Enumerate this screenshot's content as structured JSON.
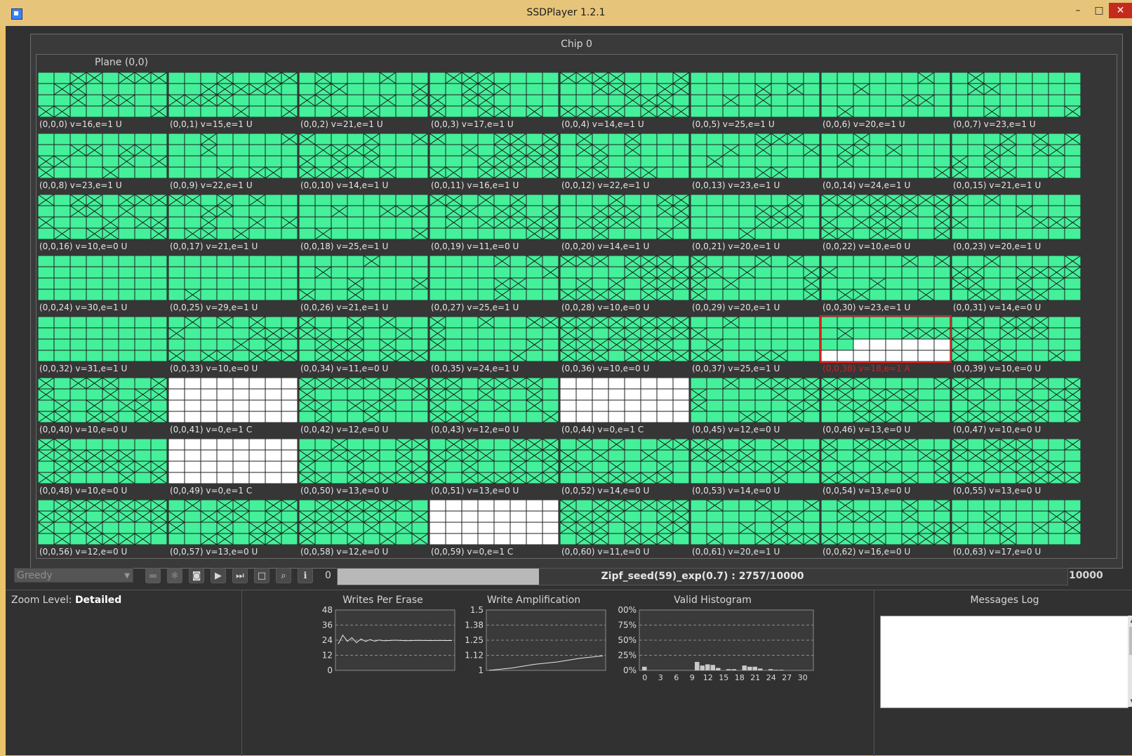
{
  "window": {
    "title": "SSDPlayer 1.2.1",
    "min": "–",
    "max": "□",
    "close": "✕"
  },
  "chip_title": "Chip 0",
  "plane_title": "Plane (0,0)",
  "blocks": [
    {
      "label": "(0,0,0) v=16,e=1 U",
      "state": "mixed"
    },
    {
      "label": "(0,0,1) v=15,e=1 U",
      "state": "mixed"
    },
    {
      "label": "(0,0,2) v=21,e=1 U",
      "state": "mixed"
    },
    {
      "label": "(0,0,3) v=17,e=1 U",
      "state": "mixed"
    },
    {
      "label": "(0,0,4) v=14,e=1 U",
      "state": "mixed"
    },
    {
      "label": "(0,0,5) v=25,e=1 U",
      "state": "mixed"
    },
    {
      "label": "(0,0,6) v=20,e=1 U",
      "state": "mixed"
    },
    {
      "label": "(0,0,7) v=23,e=1 U",
      "state": "mixed"
    },
    {
      "label": "(0,0,8) v=23,e=1 U",
      "state": "mixed"
    },
    {
      "label": "(0,0,9) v=22,e=1 U",
      "state": "mixed"
    },
    {
      "label": "(0,0,10) v=14,e=1 U",
      "state": "mixed"
    },
    {
      "label": "(0,0,11) v=16,e=1 U",
      "state": "mixed"
    },
    {
      "label": "(0,0,12) v=22,e=1 U",
      "state": "mixed"
    },
    {
      "label": "(0,0,13) v=23,e=1 U",
      "state": "mixed"
    },
    {
      "label": "(0,0,14) v=24,e=1 U",
      "state": "mixed"
    },
    {
      "label": "(0,0,15) v=21,e=1 U",
      "state": "mixed"
    },
    {
      "label": "(0,0,16) v=10,e=0 U",
      "state": "mixed"
    },
    {
      "label": "(0,0,17) v=21,e=1 U",
      "state": "mixed"
    },
    {
      "label": "(0,0,18) v=25,e=1 U",
      "state": "mixed"
    },
    {
      "label": "(0,0,19) v=11,e=0 U",
      "state": "mixed"
    },
    {
      "label": "(0,0,20) v=14,e=1 U",
      "state": "mixed"
    },
    {
      "label": "(0,0,21) v=20,e=1 U",
      "state": "mixed"
    },
    {
      "label": "(0,0,22) v=10,e=0 U",
      "state": "mixed"
    },
    {
      "label": "(0,0,23) v=20,e=1 U",
      "state": "mixed"
    },
    {
      "label": "(0,0,24) v=30,e=1 U",
      "state": "mixed"
    },
    {
      "label": "(0,0,25) v=29,e=1 U",
      "state": "mixed"
    },
    {
      "label": "(0,0,26) v=21,e=1 U",
      "state": "mixed"
    },
    {
      "label": "(0,0,27) v=25,e=1 U",
      "state": "mixed"
    },
    {
      "label": "(0,0,28) v=10,e=0 U",
      "state": "mixed"
    },
    {
      "label": "(0,0,29) v=20,e=1 U",
      "state": "mixed"
    },
    {
      "label": "(0,0,30) v=23,e=1 U",
      "state": "mixed"
    },
    {
      "label": "(0,0,31) v=14,e=0 U",
      "state": "mixed"
    },
    {
      "label": "(0,0,32) v=31,e=1 U",
      "state": "mixed"
    },
    {
      "label": "(0,0,33) v=10,e=0 U",
      "state": "mixed"
    },
    {
      "label": "(0,0,34) v=11,e=0 U",
      "state": "mixed"
    },
    {
      "label": "(0,0,35) v=24,e=1 U",
      "state": "mixed"
    },
    {
      "label": "(0,0,36) v=10,e=0 U",
      "state": "mixed"
    },
    {
      "label": "(0,0,37) v=25,e=1 U",
      "state": "mixed"
    },
    {
      "label": "(0,0,38) v=18,e=1 A",
      "state": "active"
    },
    {
      "label": "(0,0,39) v=10,e=0 U",
      "state": "mixed"
    },
    {
      "label": "(0,0,40) v=10,e=0 U",
      "state": "mixed"
    },
    {
      "label": "(0,0,41) v=0,e=1 C",
      "state": "clean"
    },
    {
      "label": "(0,0,42) v=12,e=0 U",
      "state": "mixed"
    },
    {
      "label": "(0,0,43) v=12,e=0 U",
      "state": "mixed"
    },
    {
      "label": "(0,0,44) v=0,e=1 C",
      "state": "clean"
    },
    {
      "label": "(0,0,45) v=12,e=0 U",
      "state": "mixed"
    },
    {
      "label": "(0,0,46) v=13,e=0 U",
      "state": "mixed"
    },
    {
      "label": "(0,0,47) v=10,e=0 U",
      "state": "mixed"
    },
    {
      "label": "(0,0,48) v=10,e=0 U",
      "state": "mixed"
    },
    {
      "label": "(0,0,49) v=0,e=1 C",
      "state": "clean"
    },
    {
      "label": "(0,0,50) v=13,e=0 U",
      "state": "mixed"
    },
    {
      "label": "(0,0,51) v=13,e=0 U",
      "state": "mixed"
    },
    {
      "label": "(0,0,52) v=14,e=0 U",
      "state": "mixed"
    },
    {
      "label": "(0,0,53) v=14,e=0 U",
      "state": "mixed"
    },
    {
      "label": "(0,0,54) v=13,e=0 U",
      "state": "mixed"
    },
    {
      "label": "(0,0,55) v=13,e=0 U",
      "state": "mixed"
    },
    {
      "label": "(0,0,56) v=12,e=0 U",
      "state": "mixed"
    },
    {
      "label": "(0,0,57) v=13,e=0 U",
      "state": "mixed"
    },
    {
      "label": "(0,0,58) v=12,e=0 U",
      "state": "mixed"
    },
    {
      "label": "(0,0,59) v=0,e=1 C",
      "state": "clean"
    },
    {
      "label": "(0,0,60) v=11,e=0 U",
      "state": "mixed"
    },
    {
      "label": "(0,0,61) v=20,e=1 U",
      "state": "mixed"
    },
    {
      "label": "(0,0,62) v=16,e=0 U",
      "state": "mixed"
    },
    {
      "label": "(0,0,63) v=17,e=0 U",
      "state": "mixed"
    }
  ],
  "colors": {
    "valid_page": "#44f09a",
    "clean_page": "#ffffff",
    "selected": "#d62020"
  },
  "toolbar": {
    "manager": "Greedy",
    "counter_start": "0",
    "progress_text": "Zipf_seed(59)_exp(0.7) : 2757/10000",
    "progress_fraction": 0.2757,
    "counter_end": "10000",
    "icons": [
      "stop-icon",
      "settings-icon",
      "camera-icon",
      "play-icon",
      "step-icon",
      "square-icon",
      "zoom-icon",
      "info-icon"
    ]
  },
  "zoom": {
    "label": "Zoom Level:",
    "value": "Detailed"
  },
  "charts": [
    {
      "title": "Writes Per Erase",
      "type": "line",
      "yticks": [
        "48",
        "36",
        "24",
        "12",
        "0"
      ]
    },
    {
      "title": "Write Amplification",
      "type": "line",
      "yticks": [
        "1.5",
        "1.38",
        "1.25",
        "1.12",
        "1"
      ]
    },
    {
      "title": "Valid Histogram",
      "type": "bar",
      "yticks": [
        "00%",
        "75%",
        "50%",
        "25%",
        "0%"
      ],
      "xticks": [
        "0",
        "3",
        "6",
        "9",
        "12",
        "15",
        "18",
        "21",
        "24",
        "27",
        "30"
      ]
    }
  ],
  "chart_data": [
    {
      "type": "line",
      "title": "Writes Per Erase",
      "ylim": [
        0,
        48
      ],
      "x": [
        0,
        0.04,
        0.08,
        0.12,
        0.16,
        0.2,
        0.24,
        0.28,
        0.32,
        0.36,
        0.4,
        0.5,
        0.6,
        0.7,
        0.8,
        0.9,
        1.0
      ],
      "values": [
        21,
        28,
        23,
        26,
        22,
        25,
        23,
        24.5,
        23.2,
        24.1,
        23.5,
        24,
        23.6,
        23.9,
        23.7,
        23.8,
        23.7
      ]
    },
    {
      "type": "line",
      "title": "Write Amplification",
      "ylim": [
        1,
        1.5
      ],
      "x": [
        0,
        0.2,
        0.4,
        0.6,
        0.8,
        1.0
      ],
      "values": [
        1.0,
        1.02,
        1.05,
        1.07,
        1.1,
        1.12
      ]
    },
    {
      "type": "bar",
      "title": "Valid Histogram",
      "ylim": [
        0,
        100
      ],
      "categories": [
        "0",
        "1",
        "2",
        "3",
        "4",
        "5",
        "6",
        "7",
        "8",
        "9",
        "10",
        "11",
        "12",
        "13",
        "14",
        "15",
        "16",
        "17",
        "18",
        "19",
        "20",
        "21",
        "22",
        "23",
        "24",
        "25",
        "26",
        "27",
        "28",
        "29",
        "30",
        "31"
      ],
      "values": [
        6,
        0,
        0,
        0,
        0,
        0,
        0,
        0,
        0,
        0,
        14,
        8,
        10,
        9,
        4,
        0,
        2,
        2,
        0,
        8,
        6,
        6,
        3,
        0,
        2,
        1,
        1,
        0,
        0,
        0,
        0,
        0
      ]
    }
  ],
  "messages_log": {
    "title": "Messages Log",
    "up": "▲",
    "down": "▼"
  }
}
